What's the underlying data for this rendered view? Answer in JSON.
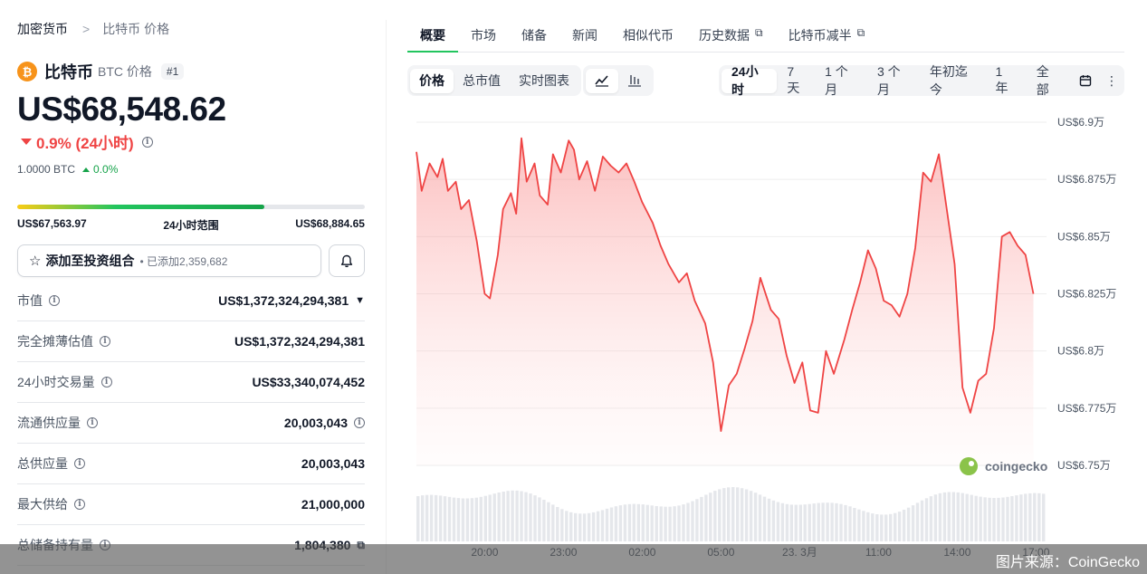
{
  "breadcrumb": {
    "root": "加密货币",
    "separator": ">",
    "current": "比特币 价格"
  },
  "coin": {
    "logo_glyph": "₿",
    "name": "比特币",
    "symbol_label": "BTC 价格",
    "rank": "#1",
    "price": "US$68,548.62",
    "change_24h": "0.9% (24小时)",
    "btc_amount": "1.0000 BTC",
    "btc_change": "0.0%"
  },
  "range_24h": {
    "low": "US$67,563.97",
    "label": "24小时范围",
    "high": "US$68,884.65",
    "fill_fraction": 0.71
  },
  "watchlist": {
    "label": "添加至投资组合",
    "count_text": "• 已添加2,359,682"
  },
  "stats": [
    {
      "label": "市值",
      "value": "US$1,372,324,294,381",
      "icon": "chevron"
    },
    {
      "label": "完全摊薄估值",
      "value": "US$1,372,324,294,381",
      "icon": ""
    },
    {
      "label": "24小时交易量",
      "value": "US$33,340,074,452",
      "icon": ""
    },
    {
      "label": "流通供应量",
      "value": "20,003,043",
      "icon": "info"
    },
    {
      "label": "总供应量",
      "value": "20,003,043",
      "icon": ""
    },
    {
      "label": "最大供给",
      "value": "21,000,000",
      "icon": ""
    },
    {
      "label": "总储备持有量",
      "value": "1,804,380",
      "icon": "external"
    }
  ],
  "tabs": [
    {
      "label": "概要",
      "active": true,
      "external": false
    },
    {
      "label": "市场",
      "active": false,
      "external": false
    },
    {
      "label": "储备",
      "active": false,
      "external": false
    },
    {
      "label": "新闻",
      "active": false,
      "external": false
    },
    {
      "label": "相似代币",
      "active": false,
      "external": false
    },
    {
      "label": "历史数据",
      "active": false,
      "external": true
    },
    {
      "label": "比特币减半",
      "active": false,
      "external": true
    }
  ],
  "chart_type_tabs": [
    "价格",
    "总市值",
    "实时图表"
  ],
  "chart_style_icons": [
    "line-chart-icon",
    "candlestick-icon"
  ],
  "time_ranges": [
    "24小时",
    "7天",
    "1 个月",
    "3 个月",
    "年初迄今",
    "1 年",
    "全部"
  ],
  "colors": {
    "accent_green": "#22c55e",
    "line_red": "#ef4444",
    "btc_orange": "#f7931a"
  },
  "chart_data": {
    "type": "area",
    "title": "",
    "ylabel": "",
    "y_tick_labels": [
      "US$6.9万",
      "US$6.875万",
      "US$6.85万",
      "US$6.825万",
      "US$6.8万",
      "US$6.775万",
      "US$6.75万"
    ],
    "y_ticks": [
      69000,
      68750,
      68500,
      68250,
      68000,
      67750,
      67500
    ],
    "ylim": [
      67500,
      69000
    ],
    "x_tick_labels": [
      "20:00",
      "23:00",
      "02:00",
      "05:00",
      "23. 3月",
      "11:00",
      "14:00",
      "17:00"
    ],
    "x_tick_positions_hours": [
      2.6,
      5.6,
      8.6,
      11.6,
      14.6,
      17.6,
      20.6,
      23.6
    ],
    "x_range_hours": [
      0,
      24
    ],
    "grid": true,
    "series": [
      {
        "points": [
          [
            0.0,
            68870
          ],
          [
            0.2,
            68700
          ],
          [
            0.5,
            68820
          ],
          [
            0.8,
            68760
          ],
          [
            1.0,
            68840
          ],
          [
            1.2,
            68700
          ],
          [
            1.5,
            68740
          ],
          [
            1.7,
            68620
          ],
          [
            2.0,
            68660
          ],
          [
            2.3,
            68480
          ],
          [
            2.6,
            68250
          ],
          [
            2.8,
            68230
          ],
          [
            3.1,
            68420
          ],
          [
            3.3,
            68620
          ],
          [
            3.6,
            68690
          ],
          [
            3.8,
            68600
          ],
          [
            4.0,
            68930
          ],
          [
            4.2,
            68740
          ],
          [
            4.5,
            68820
          ],
          [
            4.7,
            68680
          ],
          [
            5.0,
            68640
          ],
          [
            5.2,
            68860
          ],
          [
            5.5,
            68780
          ],
          [
            5.8,
            68920
          ],
          [
            6.0,
            68880
          ],
          [
            6.2,
            68750
          ],
          [
            6.5,
            68830
          ],
          [
            6.8,
            68700
          ],
          [
            7.1,
            68850
          ],
          [
            7.4,
            68810
          ],
          [
            7.7,
            68780
          ],
          [
            8.0,
            68820
          ],
          [
            8.3,
            68740
          ],
          [
            8.6,
            68650
          ],
          [
            9.0,
            68560
          ],
          [
            9.3,
            68460
          ],
          [
            9.6,
            68380
          ],
          [
            10.0,
            68300
          ],
          [
            10.3,
            68340
          ],
          [
            10.6,
            68220
          ],
          [
            11.0,
            68120
          ],
          [
            11.3,
            67950
          ],
          [
            11.6,
            67650
          ],
          [
            11.9,
            67850
          ],
          [
            12.2,
            67900
          ],
          [
            12.5,
            68010
          ],
          [
            12.8,
            68130
          ],
          [
            13.1,
            68320
          ],
          [
            13.5,
            68180
          ],
          [
            13.8,
            68140
          ],
          [
            14.1,
            67980
          ],
          [
            14.4,
            67860
          ],
          [
            14.7,
            67950
          ],
          [
            15.0,
            67740
          ],
          [
            15.3,
            67730
          ],
          [
            15.6,
            68000
          ],
          [
            15.9,
            67900
          ],
          [
            16.3,
            68050
          ],
          [
            16.6,
            68180
          ],
          [
            16.9,
            68300
          ],
          [
            17.2,
            68440
          ],
          [
            17.5,
            68360
          ],
          [
            17.8,
            68220
          ],
          [
            18.1,
            68200
          ],
          [
            18.4,
            68150
          ],
          [
            18.7,
            68250
          ],
          [
            19.0,
            68450
          ],
          [
            19.3,
            68780
          ],
          [
            19.6,
            68740
          ],
          [
            19.9,
            68860
          ],
          [
            20.2,
            68620
          ],
          [
            20.5,
            68380
          ],
          [
            20.8,
            67840
          ],
          [
            21.1,
            67730
          ],
          [
            21.4,
            67870
          ],
          [
            21.7,
            67900
          ],
          [
            22.0,
            68100
          ],
          [
            22.3,
            68500
          ],
          [
            22.6,
            68520
          ],
          [
            22.9,
            68460
          ],
          [
            23.2,
            68420
          ],
          [
            23.5,
            68250
          ]
        ]
      }
    ],
    "volume_caption": "",
    "watermark": "coingecko"
  },
  "credit": "图片来源：CoinGecko"
}
